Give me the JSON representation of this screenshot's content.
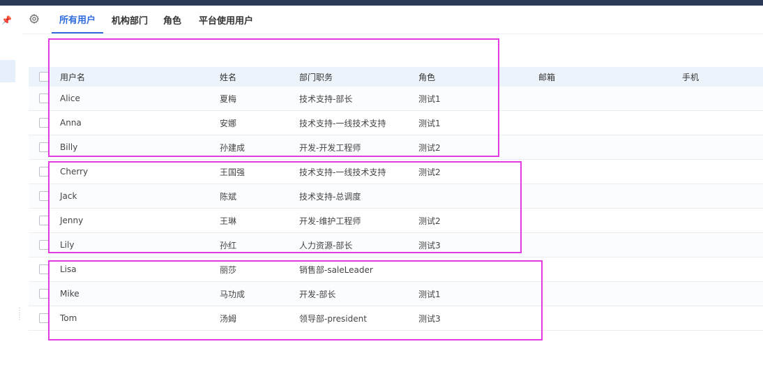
{
  "tabs": [
    {
      "label": "所有用户",
      "active": true
    },
    {
      "label": "机构部门",
      "active": false
    },
    {
      "label": "角色",
      "active": false
    },
    {
      "label": "平台使用用户",
      "active": false
    }
  ],
  "table": {
    "columns": {
      "username": "用户名",
      "name": "姓名",
      "dept": "部门职务",
      "role": "角色",
      "email": "邮箱",
      "phone": "手机"
    },
    "rows": [
      {
        "username": "Alice",
        "name": "夏梅",
        "dept": "技术支持-部长",
        "role": "测试1",
        "email": "",
        "phone": ""
      },
      {
        "username": "Anna",
        "name": "安娜",
        "dept": "技术支持-一线技术支持",
        "role": "测试1",
        "email": "",
        "phone": ""
      },
      {
        "username": "Billy",
        "name": "孙建成",
        "dept": "开发-开发工程师",
        "role": "测试2",
        "email": "",
        "phone": ""
      },
      {
        "username": "Cherry",
        "name": "王国强",
        "dept": "技术支持-一线技术支持",
        "role": "测试2",
        "email": "",
        "phone": ""
      },
      {
        "username": "Jack",
        "name": "陈斌",
        "dept": "技术支持-总调度",
        "role": "",
        "email": "",
        "phone": ""
      },
      {
        "username": "Jenny",
        "name": "王琳",
        "dept": "开发-维护工程师",
        "role": "测试2",
        "email": "",
        "phone": ""
      },
      {
        "username": "Lily",
        "name": "孙红",
        "dept": "人力资源-部长",
        "role": "测试3",
        "email": "",
        "phone": ""
      },
      {
        "username": "Lisa",
        "name": "丽莎",
        "dept": "销售部-saleLeader",
        "role": "",
        "email": "",
        "phone": ""
      },
      {
        "username": "Mike",
        "name": "马功成",
        "dept": "开发-部长",
        "role": "测试1",
        "email": "",
        "phone": ""
      },
      {
        "username": "Tom",
        "name": "汤姆",
        "dept": "领导部-president",
        "role": "测试3",
        "email": "",
        "phone": ""
      }
    ]
  },
  "colors": {
    "accent": "#2f6bdc",
    "annotation": "#e23ce0",
    "topbar": "#2b3b55"
  },
  "icons": {
    "pin": "pin-icon",
    "settings": "gear-icon",
    "drag": "drag-handle-icon"
  }
}
